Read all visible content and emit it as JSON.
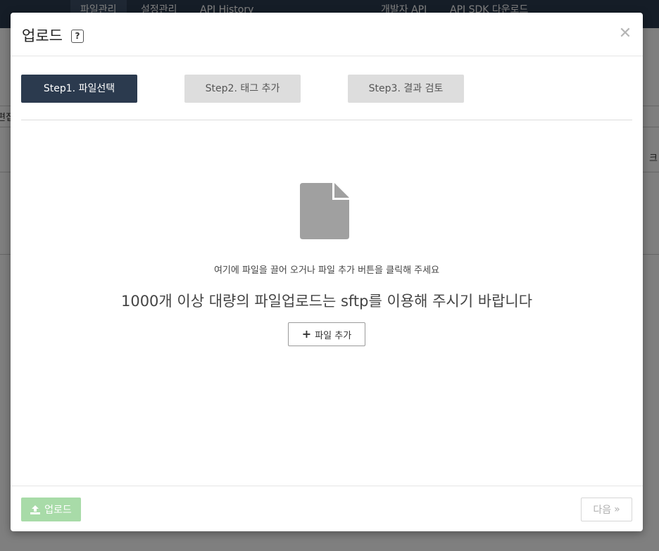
{
  "background": {
    "nav": [
      "파일관리",
      "설정관리",
      "API History",
      "개발자 API",
      "API SDK 다운로드"
    ],
    "edge_left_text": "편집",
    "edge_right_text": "크"
  },
  "modal": {
    "title": "업로드",
    "help_label": "?",
    "close_label": "✕",
    "steps": [
      {
        "label": "Step1. 파일선택",
        "state": "active"
      },
      {
        "label": "Step2. 태그 추가",
        "state": "inactive"
      },
      {
        "label": "Step3. 결과 검토",
        "state": "inactive"
      }
    ],
    "icon": "file-icon",
    "drop_hint": "여기에 파일을 끌어 오거나 파일 추가 버튼을 클릭해 주세요",
    "bulk_note": "1000개 이상 대량의 파일업로드는 sftp를 이용해 주시기 바랍니다",
    "add_file_label": "파일 추가",
    "footer": {
      "upload_label": "업로드",
      "next_label": "다음",
      "next_arrow": "»"
    }
  },
  "colors": {
    "nav_bg": "#2b3a4e",
    "step_active": "#2b3a4e",
    "step_inactive": "#dddddd",
    "upload_disabled": "#a8dba8"
  }
}
